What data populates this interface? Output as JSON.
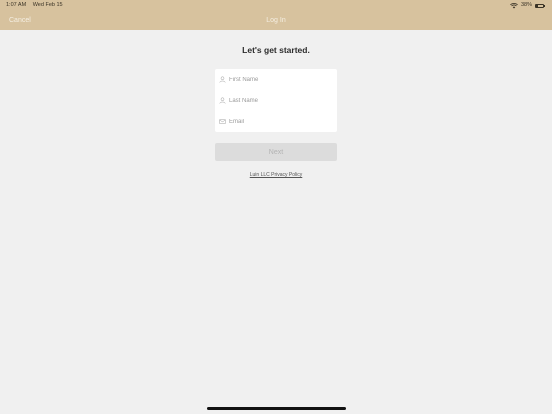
{
  "status_bar": {
    "time": "1:07 AM",
    "date": "Wed Feb 15",
    "battery": "38%"
  },
  "nav": {
    "cancel_label": "Cancel",
    "title": "Log In"
  },
  "main": {
    "heading": "Let's get started.",
    "fields": [
      {
        "name": "first-name",
        "placeholder": "First Name",
        "icon": "person-icon",
        "value": ""
      },
      {
        "name": "last-name",
        "placeholder": "Last Name",
        "icon": "person-icon",
        "value": ""
      },
      {
        "name": "email",
        "placeholder": "Email",
        "icon": "envelope-icon",
        "value": ""
      }
    ],
    "next_label": "Next",
    "privacy_link": "Luin LLC Privacy Policy"
  },
  "colors": {
    "header": "#d7c29e",
    "background": "#f0f0f0",
    "button_disabled": "#dcdcdc"
  }
}
